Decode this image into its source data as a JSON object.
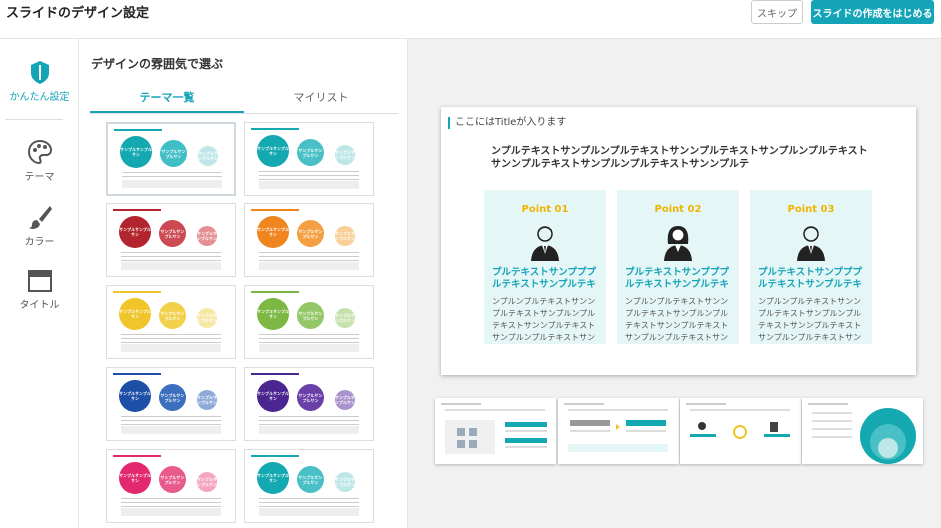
{
  "header": {
    "title": "スライドのデザイン設定",
    "skip_label": "スキップ",
    "start_label": "スライドの作成をはじめる"
  },
  "rail": {
    "items": [
      {
        "label": "かんたん設定",
        "icon": "shield-icon",
        "active": true
      },
      {
        "label": "テーマ",
        "icon": "palette-icon",
        "active": false
      },
      {
        "label": "カラー",
        "icon": "brush-icon",
        "active": false
      },
      {
        "label": "タイトル",
        "icon": "layout-icon",
        "active": false
      }
    ]
  },
  "panel": {
    "title": "デザインの雰囲気で選ぶ",
    "tabs": [
      {
        "label": "テーマ一覧",
        "active": true
      },
      {
        "label": "マイリスト",
        "active": false
      }
    ]
  },
  "themes": [
    {
      "color": "#14a8b0",
      "c2": "#3fbec4",
      "c3": "#bfe6e8",
      "label": "サンプルサンプルサン"
    },
    {
      "color": "#14a8b0",
      "c2": "#49c0c5",
      "c3": "#bde6e7",
      "label": "サンプルサンプルサン"
    },
    {
      "color": "#b3252e",
      "c2": "#cc4b52",
      "c3": "#e48f94",
      "label": "サンプルサンプルサン"
    },
    {
      "color": "#f08520",
      "c2": "#f3a043",
      "c3": "#f8cf96",
      "label": "サンプルサンプルサン"
    },
    {
      "color": "#f0c52a",
      "c2": "#f2d14a",
      "c3": "#f7e7a4",
      "label": "サンプルサンプルサン"
    },
    {
      "color": "#7cb843",
      "c2": "#94c767",
      "c3": "#c7e1ad",
      "label": "サンプルサンプルサン"
    },
    {
      "color": "#1e4fa6",
      "c2": "#3b6ebd",
      "c3": "#8fa9da",
      "label": "サンプルサンプルサン"
    },
    {
      "color": "#4b2590",
      "c2": "#6a3fa8",
      "c3": "#a993cf",
      "label": "サンプルサンプルサン"
    },
    {
      "color": "#e3286e",
      "c2": "#e85a8c",
      "c3": "#f4a5c2",
      "label": "サンプルサンプルサン"
    },
    {
      "color": "#14a8b0",
      "c2": "#49c0c5",
      "c3": "#bde6e7",
      "label": "サンプルサンプルサン"
    }
  ],
  "slide": {
    "title": "ここにはTitleが入ります",
    "lead": "ンプルテキストサンプルンプルテキストサンンプルテキストサンプルンプルテキストサンンプルテキストサンプルンプルテキストサンンプルテ",
    "points": [
      {
        "label": "Point 01",
        "head": "プルテキストサンプププルテキストサンプルテキ",
        "body": "ンプルンプルテキストサンンプルテキストサンプルンプルテキストサンンプルテキストサンプルンプルテキストサン",
        "person": "man"
      },
      {
        "label": "Point 02",
        "head": "プルテキストサンプププルテキストサンプルテキ",
        "body": "ンプルンプルテキストサンンプルテキストサンプルンプルテキストサンンプルテキストサンプルンプルテキストサン",
        "person": "woman"
      },
      {
        "label": "Point 03",
        "head": "プルテキストサンプププルテキストサンプルテキ",
        "body": "ンプルンプルテキストサンンプルテキストサンプルンプルテキストサンンプルテキストサンプルンプルテキストサン",
        "person": "man"
      }
    ]
  },
  "colors": {
    "accent": "#14a4b8",
    "point_label": "#f0b400",
    "point_bg": "#e5f6f6"
  }
}
